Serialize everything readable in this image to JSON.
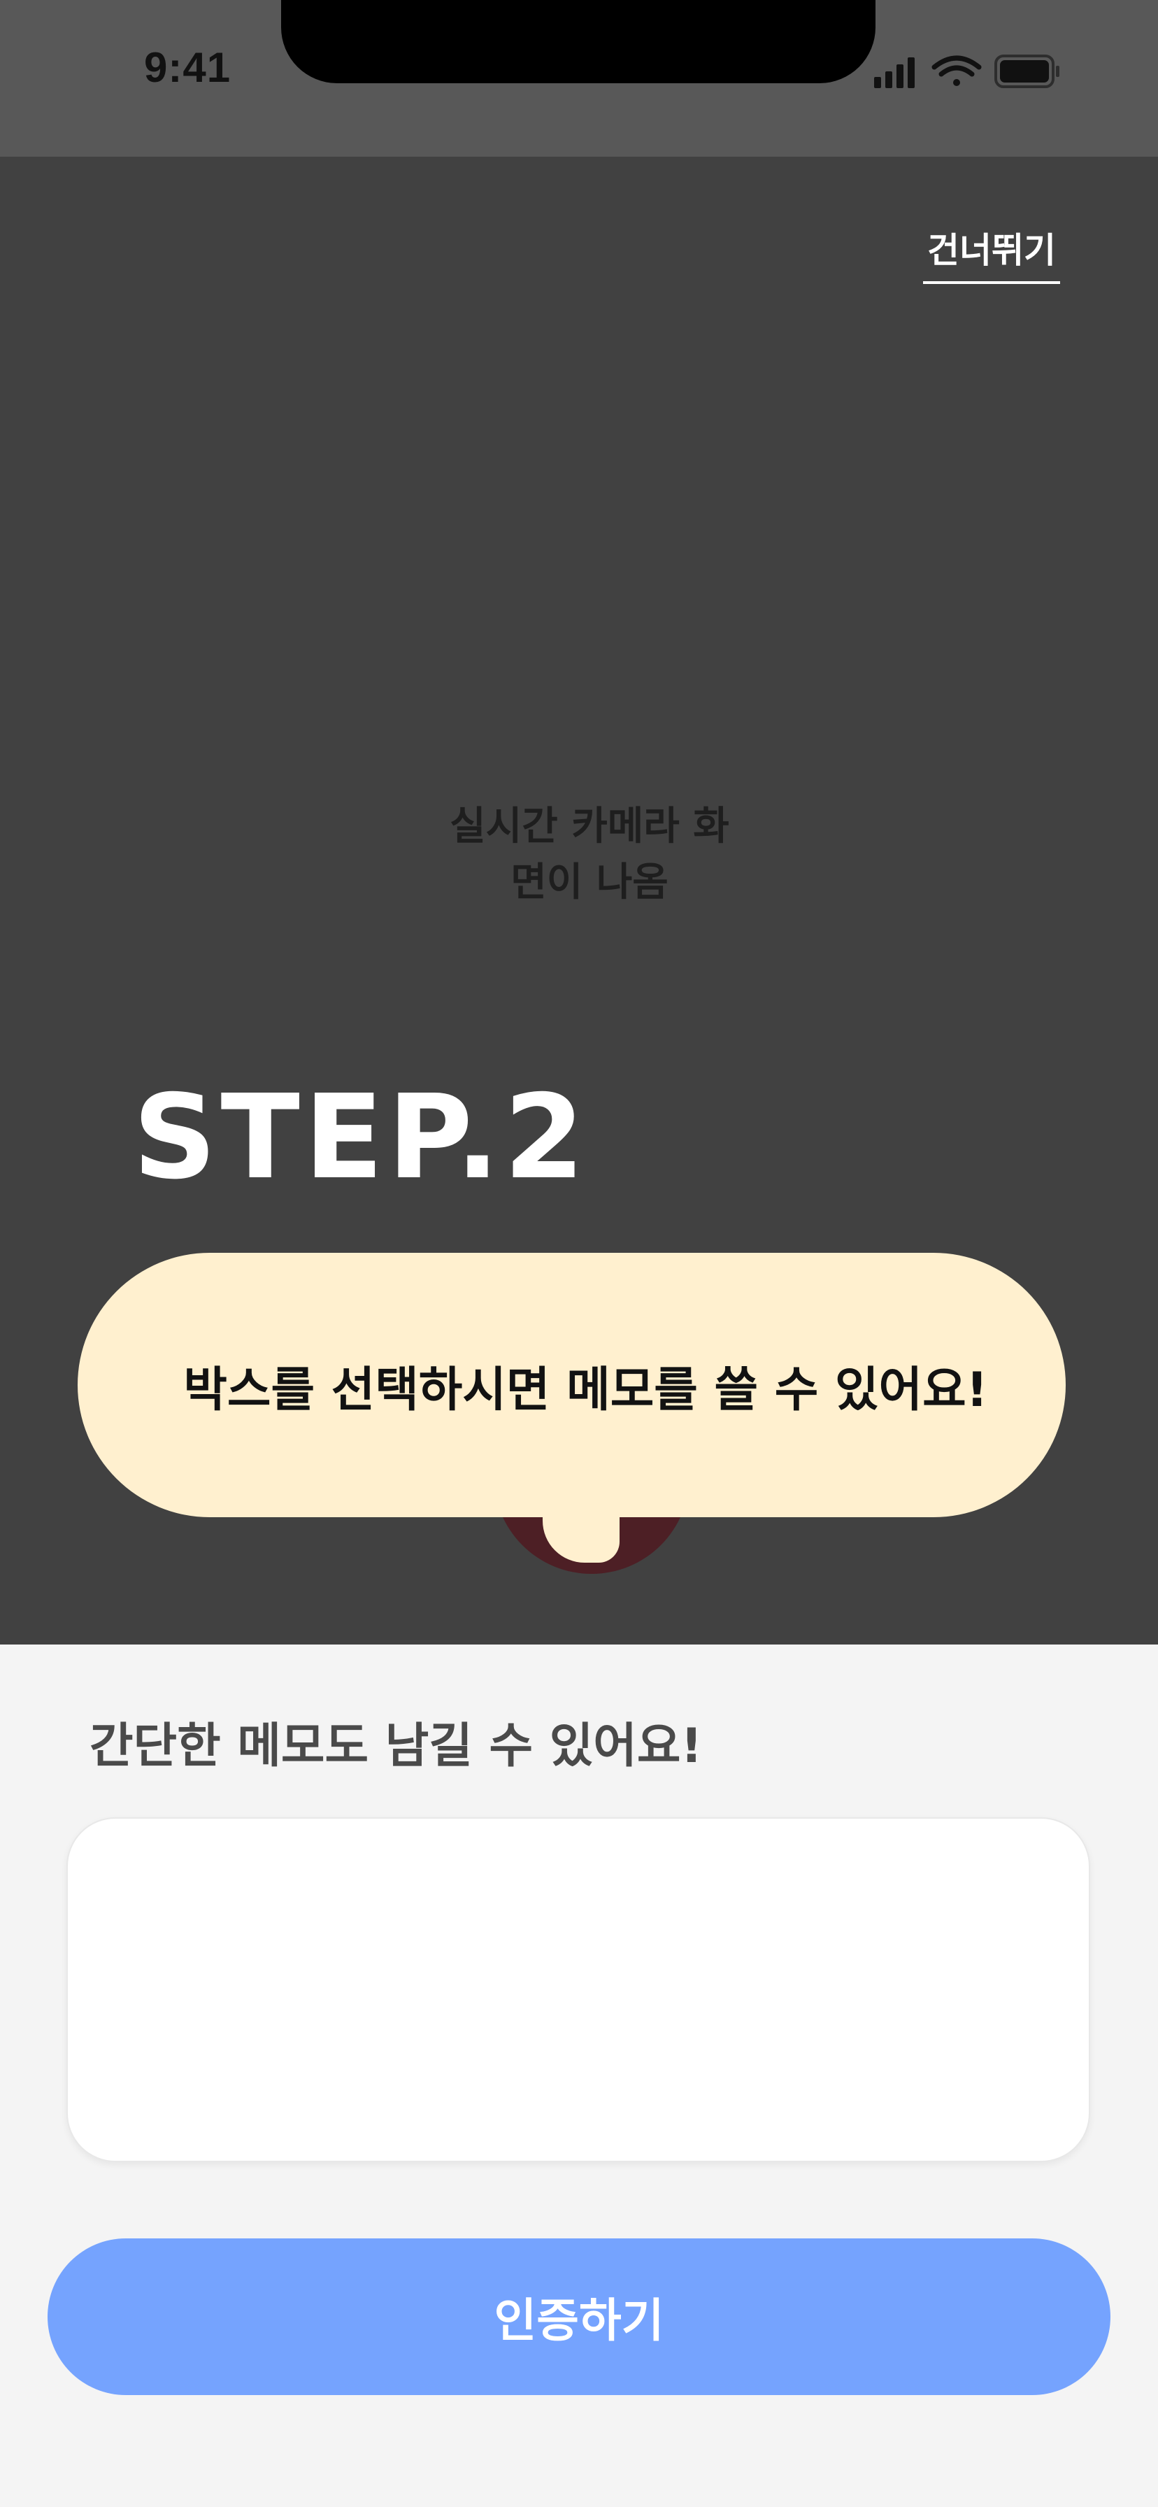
{
  "status_bar": {
    "time": "9:41",
    "icons": [
      "signal-icon",
      "wifi-icon",
      "battery-icon"
    ]
  },
  "header": {
    "skip_label": "건너뛰기"
  },
  "camera": {
    "placeholder_line1": "실시간 카메라 화",
    "placeholder_line2": "면이 나옴"
  },
  "tutorial": {
    "step": "STEP.2",
    "tooltip": "박스를 선택하시면 메모를 쓸 수 있어요!"
  },
  "memo": {
    "label": "간단한 메모도 남길 수 있어요!",
    "value": "",
    "placeholder": ""
  },
  "actions": {
    "submit_label": "인증하기"
  },
  "colors": {
    "status_bar_bg": "#585858",
    "camera_bg": "#414141",
    "tooltip_bg": "#fff0cf",
    "sheet_bg": "#f4f4f4",
    "button_bg": "#75a3fe"
  }
}
